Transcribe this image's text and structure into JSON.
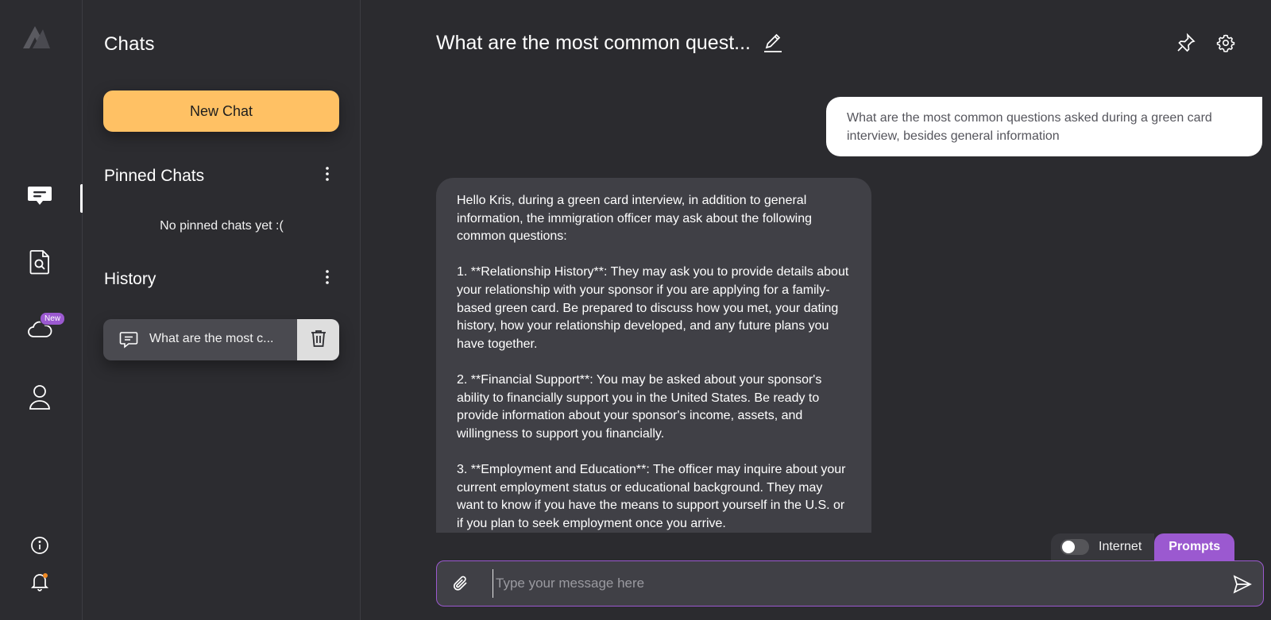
{
  "rail": {
    "new_badge": "New"
  },
  "panel": {
    "title": "Chats",
    "new_chat_label": "New Chat",
    "pinned_title": "Pinned Chats",
    "pinned_empty": "No pinned chats yet :(",
    "history_title": "History",
    "history_items": [
      {
        "label": "What are the most c..."
      }
    ]
  },
  "main": {
    "title": "What are the most common quest...",
    "user_message": "What are the most common questions asked during a green card interview, besides general information",
    "bot_message": {
      "intro": "Hello Kris, during a green card interview, in addition to general information, the immigration officer may ask about the following common questions:",
      "p1": "1. **Relationship History**: They may ask you to provide details about your relationship with your sponsor if you are applying for a family-based green card. Be prepared to discuss how you met, your dating history, how your relationship developed, and any future plans you have together.",
      "p2": "2. **Financial Support**: You may be asked about your sponsor's ability to financially support you in the United States. Be ready to provide information about your sponsor's income, assets, and willingness to support you financially.",
      "p3": "3. **Employment and Education**: The officer may inquire about your current employment status or educational background. They may want to know if you have the means to support yourself in the U.S. or if you plan to seek employment once you arrive."
    },
    "internet_label": "Internet",
    "internet_enabled": false,
    "prompts_label": "Prompts",
    "composer_placeholder": "Type your message here"
  },
  "colors": {
    "background": "#2b2b2f",
    "accent_yellow": "#ffc164",
    "accent_purple": "#9b59d0",
    "bubble_bot": "#404046",
    "bubble_user": "#ffffff"
  }
}
